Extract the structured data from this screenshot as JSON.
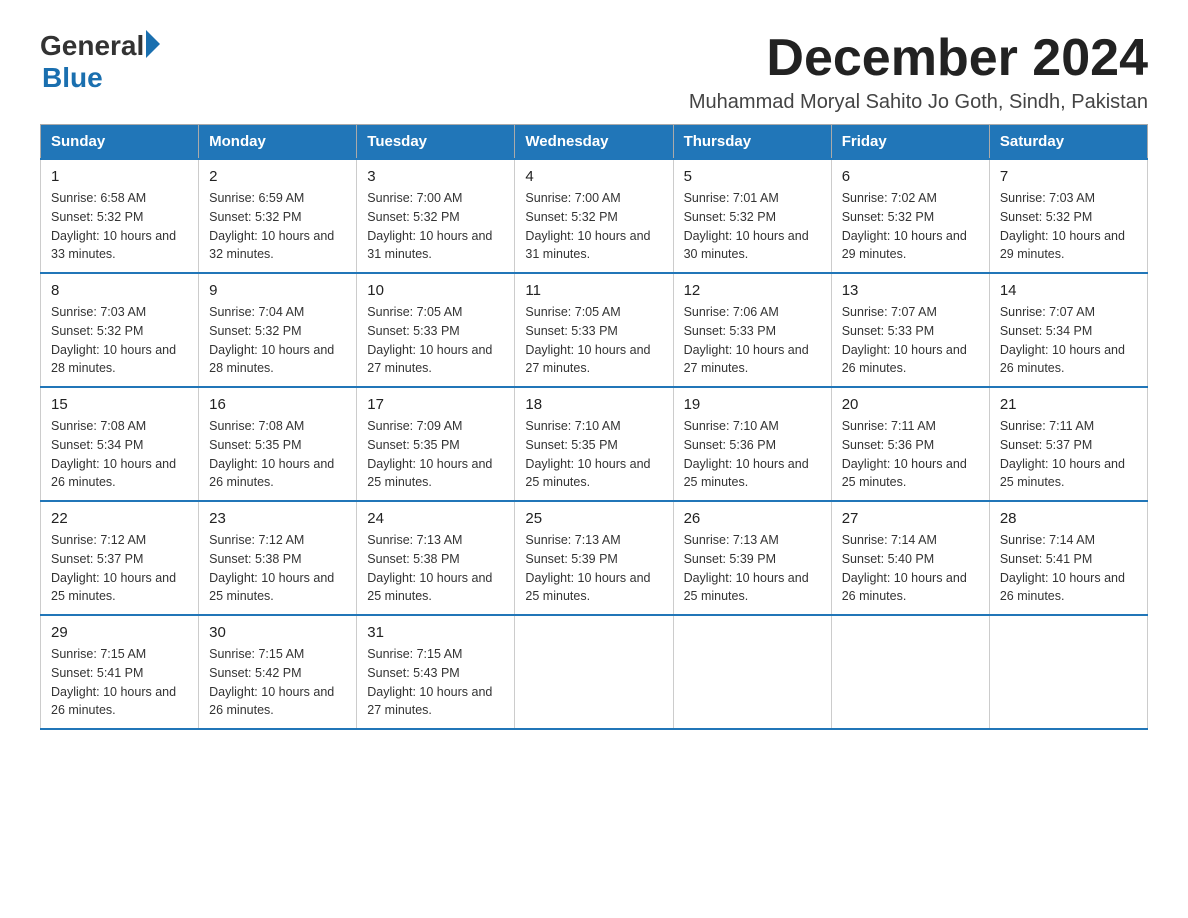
{
  "logo": {
    "general": "General",
    "blue": "Blue",
    "arrow": "▶"
  },
  "title": "December 2024",
  "subtitle": "Muhammad Moryal Sahito Jo Goth, Sindh, Pakistan",
  "days_of_week": [
    "Sunday",
    "Monday",
    "Tuesday",
    "Wednesday",
    "Thursday",
    "Friday",
    "Saturday"
  ],
  "weeks": [
    [
      {
        "day": "1",
        "sunrise": "6:58 AM",
        "sunset": "5:32 PM",
        "daylight": "10 hours and 33 minutes."
      },
      {
        "day": "2",
        "sunrise": "6:59 AM",
        "sunset": "5:32 PM",
        "daylight": "10 hours and 32 minutes."
      },
      {
        "day": "3",
        "sunrise": "7:00 AM",
        "sunset": "5:32 PM",
        "daylight": "10 hours and 31 minutes."
      },
      {
        "day": "4",
        "sunrise": "7:00 AM",
        "sunset": "5:32 PM",
        "daylight": "10 hours and 31 minutes."
      },
      {
        "day": "5",
        "sunrise": "7:01 AM",
        "sunset": "5:32 PM",
        "daylight": "10 hours and 30 minutes."
      },
      {
        "day": "6",
        "sunrise": "7:02 AM",
        "sunset": "5:32 PM",
        "daylight": "10 hours and 29 minutes."
      },
      {
        "day": "7",
        "sunrise": "7:03 AM",
        "sunset": "5:32 PM",
        "daylight": "10 hours and 29 minutes."
      }
    ],
    [
      {
        "day": "8",
        "sunrise": "7:03 AM",
        "sunset": "5:32 PM",
        "daylight": "10 hours and 28 minutes."
      },
      {
        "day": "9",
        "sunrise": "7:04 AM",
        "sunset": "5:32 PM",
        "daylight": "10 hours and 28 minutes."
      },
      {
        "day": "10",
        "sunrise": "7:05 AM",
        "sunset": "5:33 PM",
        "daylight": "10 hours and 27 minutes."
      },
      {
        "day": "11",
        "sunrise": "7:05 AM",
        "sunset": "5:33 PM",
        "daylight": "10 hours and 27 minutes."
      },
      {
        "day": "12",
        "sunrise": "7:06 AM",
        "sunset": "5:33 PM",
        "daylight": "10 hours and 27 minutes."
      },
      {
        "day": "13",
        "sunrise": "7:07 AM",
        "sunset": "5:33 PM",
        "daylight": "10 hours and 26 minutes."
      },
      {
        "day": "14",
        "sunrise": "7:07 AM",
        "sunset": "5:34 PM",
        "daylight": "10 hours and 26 minutes."
      }
    ],
    [
      {
        "day": "15",
        "sunrise": "7:08 AM",
        "sunset": "5:34 PM",
        "daylight": "10 hours and 26 minutes."
      },
      {
        "day": "16",
        "sunrise": "7:08 AM",
        "sunset": "5:35 PM",
        "daylight": "10 hours and 26 minutes."
      },
      {
        "day": "17",
        "sunrise": "7:09 AM",
        "sunset": "5:35 PM",
        "daylight": "10 hours and 25 minutes."
      },
      {
        "day": "18",
        "sunrise": "7:10 AM",
        "sunset": "5:35 PM",
        "daylight": "10 hours and 25 minutes."
      },
      {
        "day": "19",
        "sunrise": "7:10 AM",
        "sunset": "5:36 PM",
        "daylight": "10 hours and 25 minutes."
      },
      {
        "day": "20",
        "sunrise": "7:11 AM",
        "sunset": "5:36 PM",
        "daylight": "10 hours and 25 minutes."
      },
      {
        "day": "21",
        "sunrise": "7:11 AM",
        "sunset": "5:37 PM",
        "daylight": "10 hours and 25 minutes."
      }
    ],
    [
      {
        "day": "22",
        "sunrise": "7:12 AM",
        "sunset": "5:37 PM",
        "daylight": "10 hours and 25 minutes."
      },
      {
        "day": "23",
        "sunrise": "7:12 AM",
        "sunset": "5:38 PM",
        "daylight": "10 hours and 25 minutes."
      },
      {
        "day": "24",
        "sunrise": "7:13 AM",
        "sunset": "5:38 PM",
        "daylight": "10 hours and 25 minutes."
      },
      {
        "day": "25",
        "sunrise": "7:13 AM",
        "sunset": "5:39 PM",
        "daylight": "10 hours and 25 minutes."
      },
      {
        "day": "26",
        "sunrise": "7:13 AM",
        "sunset": "5:39 PM",
        "daylight": "10 hours and 25 minutes."
      },
      {
        "day": "27",
        "sunrise": "7:14 AM",
        "sunset": "5:40 PM",
        "daylight": "10 hours and 26 minutes."
      },
      {
        "day": "28",
        "sunrise": "7:14 AM",
        "sunset": "5:41 PM",
        "daylight": "10 hours and 26 minutes."
      }
    ],
    [
      {
        "day": "29",
        "sunrise": "7:15 AM",
        "sunset": "5:41 PM",
        "daylight": "10 hours and 26 minutes."
      },
      {
        "day": "30",
        "sunrise": "7:15 AM",
        "sunset": "5:42 PM",
        "daylight": "10 hours and 26 minutes."
      },
      {
        "day": "31",
        "sunrise": "7:15 AM",
        "sunset": "5:43 PM",
        "daylight": "10 hours and 27 minutes."
      },
      null,
      null,
      null,
      null
    ]
  ]
}
